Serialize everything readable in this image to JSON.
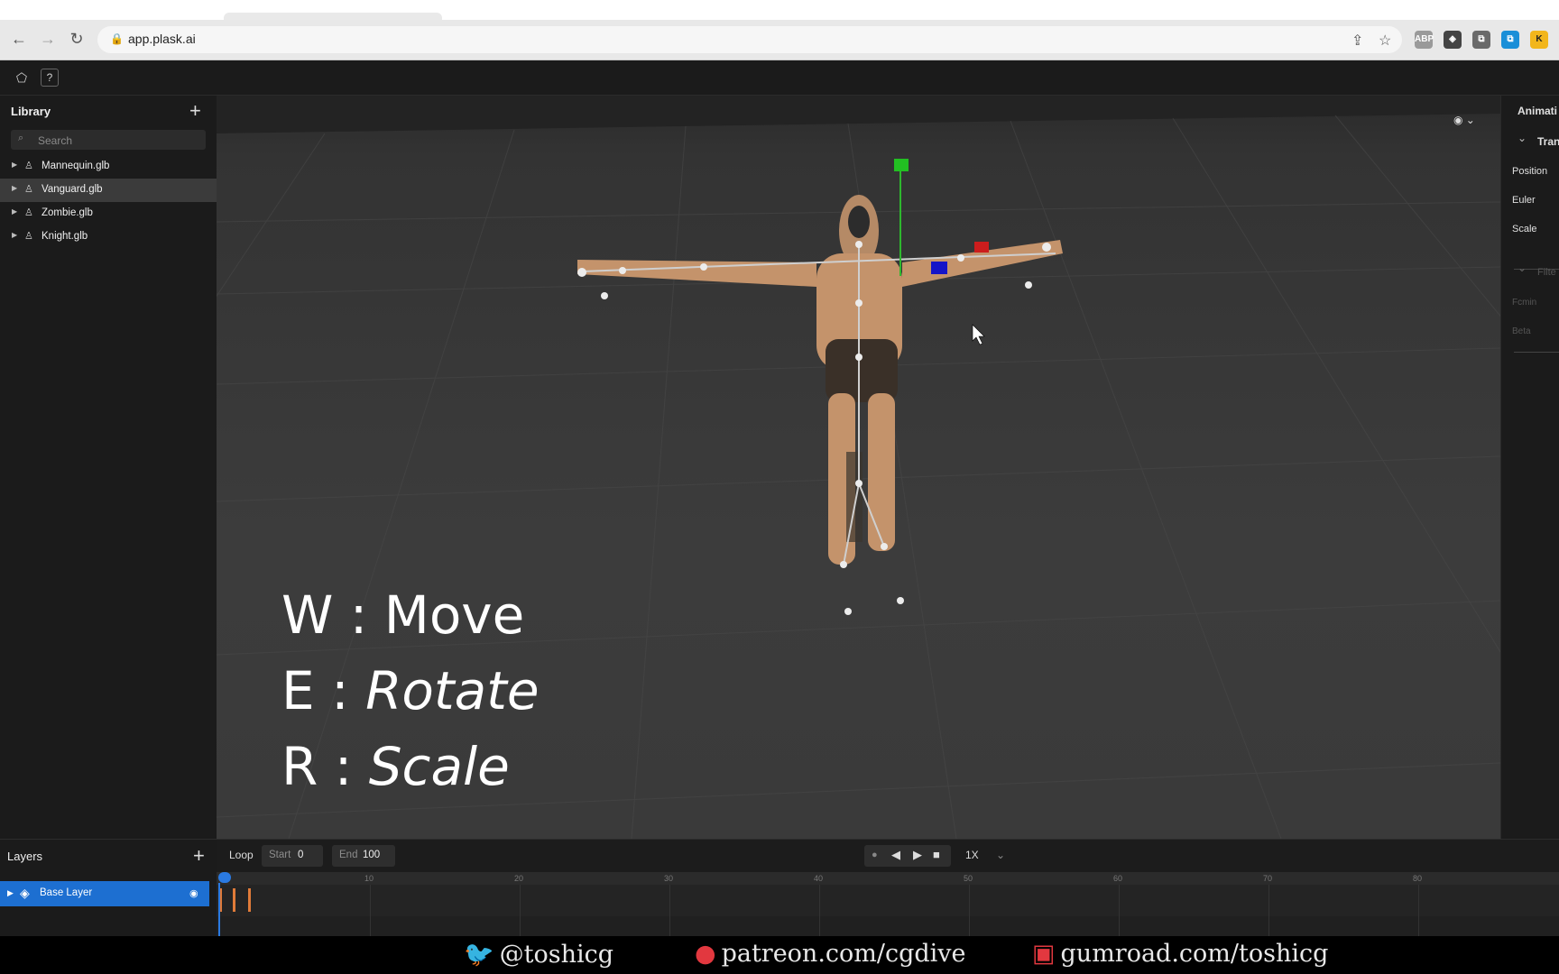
{
  "browser": {
    "url": "app.plask.ai",
    "nav": {
      "back": "←",
      "forward": "→",
      "reload": "↻",
      "lock": "🔒"
    },
    "omni_icons": {
      "share": "⇪",
      "star": "☆"
    },
    "extensions": [
      "ABP",
      "◈",
      "⧉",
      "⧉",
      "K"
    ],
    "extension_colors": [
      "#9a9a9a",
      "#444444",
      "#6a6a6a",
      "#1a8fd8",
      "#f2b61c"
    ]
  },
  "apptop": {
    "logo_icon": "⬠",
    "help_label": "?"
  },
  "library": {
    "title": "Library",
    "add_icon": "+",
    "search": {
      "placeholder": "Search",
      "icon": "⌕"
    },
    "items": [
      {
        "label": "Mannequin.glb",
        "selected": false
      },
      {
        "label": "Vanguard.glb",
        "selected": true
      },
      {
        "label": "Zombie.glb",
        "selected": false
      },
      {
        "label": "Knight.glb",
        "selected": false
      }
    ],
    "expand_icon": "▶",
    "model_icon": "♙"
  },
  "viewport": {
    "visibility_icon": "◉ ⌄",
    "hints": [
      {
        "key": "W",
        "sep": " : ",
        "action": "Move",
        "italic": false
      },
      {
        "key": "E",
        "sep": "  : ",
        "action": "Rotate",
        "italic": true
      },
      {
        "key": "R",
        "sep": "  : ",
        "action": "Scale",
        "italic": true
      }
    ]
  },
  "rightpanel": {
    "tab": "Animati",
    "section1": "Tran",
    "rows": [
      "Position",
      "Euler",
      "Scale"
    ],
    "section2": "Filte",
    "dim_rows": [
      "Fcmin",
      "Beta"
    ],
    "chevron": "⌄"
  },
  "layers": {
    "title": "Layers",
    "add_icon": "+",
    "base_layer": {
      "label": "Base Layer",
      "expand": "▶",
      "icon": "◈",
      "eye": "◉"
    }
  },
  "timeline": {
    "loop_label": "Loop",
    "start_label": "Start",
    "start_value": "0",
    "end_label": "End",
    "end_value": "100",
    "transport": {
      "record": "●",
      "prev": "◀",
      "play": "▶",
      "stop": "■"
    },
    "speed": "1X",
    "speed_chevron": "⌄",
    "ticks": [
      "0",
      "10",
      "20",
      "30",
      "40",
      "50",
      "60",
      "70",
      "80"
    ],
    "playhead_frame": 0
  },
  "footer": {
    "twitter": "@toshicg",
    "patreon": "patreon.com/cgdive",
    "gumroad": "gumroad.com/toshicg",
    "twitter_icon": "🐦",
    "patreon_icon": "●",
    "gumroad_icon": "▣",
    "colors": {
      "twitter": "#1d9bf0",
      "patreon": "#e2383f",
      "gumroad": "#e2383f"
    }
  }
}
